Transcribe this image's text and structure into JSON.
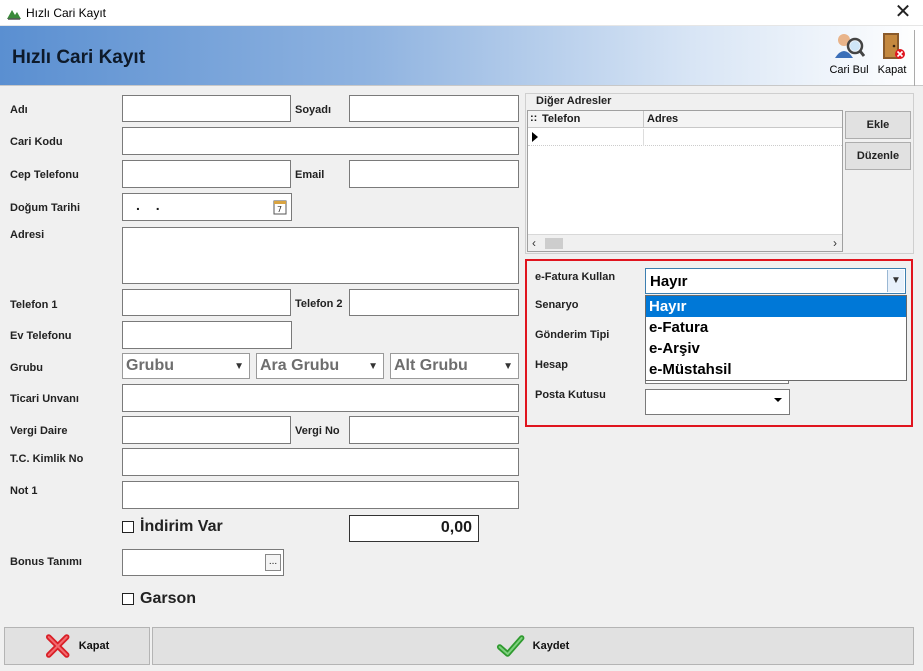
{
  "window": {
    "title": "Hızlı Cari Kayıt"
  },
  "header": {
    "title": "Hızlı Cari Kayıt",
    "buttons": {
      "cari_bul": "Cari Bul",
      "kapat": "Kapat"
    }
  },
  "form": {
    "adi": "Adı",
    "soyadi": "Soyadı",
    "cari_kodu": "Cari Kodu",
    "cep_telefonu": "Cep Telefonu",
    "email": "Email",
    "dogum_tarihi": "Doğum Tarihi",
    "dogum_tarihi_value": ". .",
    "adresi": "Adresi",
    "telefon1": "Telefon 1",
    "telefon2": "Telefon 2",
    "ev_telefonu": "Ev Telefonu",
    "grubu": "Grubu",
    "grubu_combo": "Grubu",
    "ara_grubu_combo": "Ara Grubu",
    "alt_grubu_combo": "Alt Grubu",
    "ticari_unvani": "Ticari Unvanı",
    "vergi_daire": "Vergi Daire",
    "vergi_no": "Vergi No",
    "tc_kimlik_no": "T.C. Kimlik No",
    "not1": "Not 1",
    "indirim_var": "İndirim Var",
    "indirim_amount": "0,00",
    "bonus_tanimi": "Bonus Tanımı",
    "bonus_button": "...",
    "garson": "Garson"
  },
  "addresses": {
    "title": "Diğer Adresler",
    "grid_marker": "::",
    "columns": [
      "Telefon",
      "Adres"
    ],
    "ekle": "Ekle",
    "duzenle": "Düzenle"
  },
  "efatura": {
    "e_fatura_kullan": "e-Fatura Kullan",
    "senaryo": "Senaryo",
    "gonderim_tipi": "Gönderim Tipi",
    "hesap": "Hesap",
    "posta_kutusu": "Posta Kutusu",
    "selected": "Hayır",
    "options": [
      "Hayır",
      "e-Fatura",
      "e-Arşiv",
      "e-Müstahsil"
    ]
  },
  "footer": {
    "kapat": "Kapat",
    "kaydet": "Kaydet"
  },
  "colors": {
    "accent_red": "#e0141e",
    "selection": "#0078d7",
    "header_blue": "#5a8fd1"
  }
}
